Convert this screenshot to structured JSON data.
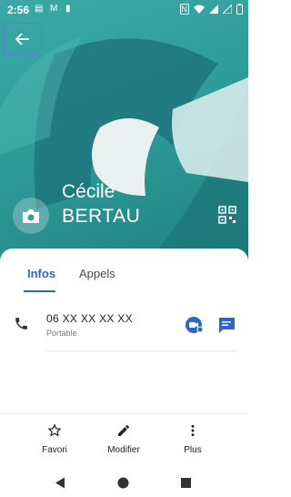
{
  "status_bar": {
    "time": "2:56",
    "notification_icons": [
      "message-icon",
      "gmail-icon",
      "trash-icon"
    ],
    "system_icons": [
      "nfc-icon",
      "wifi-icon",
      "signal-icon",
      "signal-icon",
      "battery-icon"
    ]
  },
  "contact": {
    "first_name": "Cécile",
    "last_name": "BERTAU"
  },
  "tabs": [
    {
      "label": "Infos",
      "active": true
    },
    {
      "label": "Appels",
      "active": false
    }
  ],
  "phone": {
    "number": "06 XX XX XX XX",
    "type": "Portable"
  },
  "actions": [
    {
      "label": "Favori",
      "icon": "star-outline-icon"
    },
    {
      "label": "Modifier",
      "icon": "edit-pencil-icon"
    },
    {
      "label": "Plus",
      "icon": "more-vertical-icon"
    }
  ],
  "colors": {
    "accent": "#2f66c2",
    "hero_teal": "#2f9c9a"
  }
}
